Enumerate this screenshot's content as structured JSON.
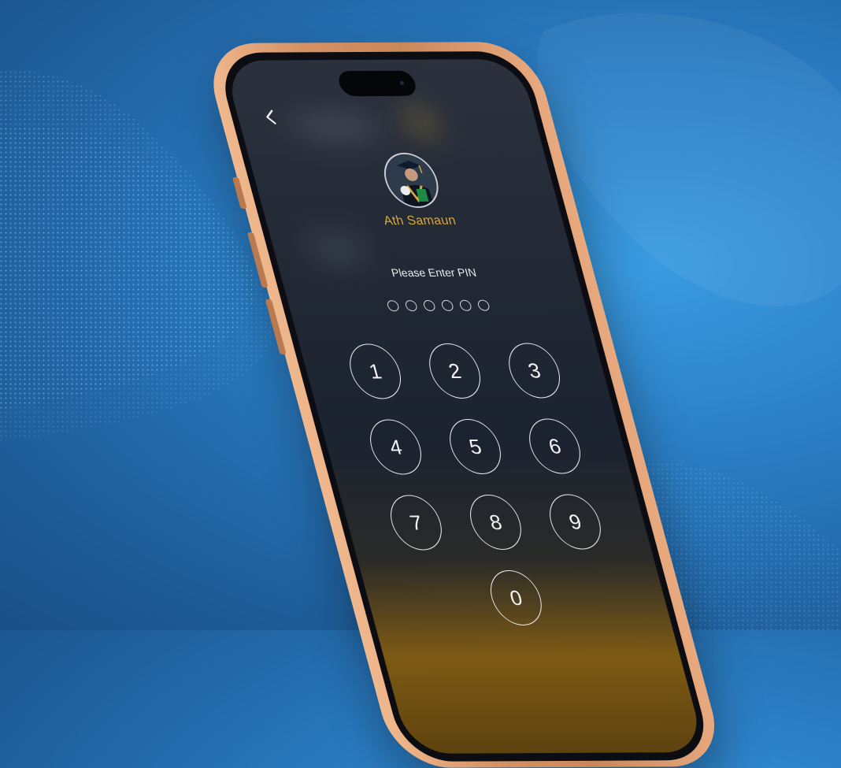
{
  "app": {
    "user_name": "Ath Samaun",
    "pin_prompt": "Please Enter PIN",
    "pin_length": 6,
    "pin_entered": 0
  },
  "icons": {
    "back": "chevron-left-icon",
    "avatar": "user-photo"
  },
  "keypad": {
    "keys": [
      "1",
      "2",
      "3",
      "4",
      "5",
      "6",
      "7",
      "8",
      "9",
      "0"
    ]
  },
  "colors": {
    "background": "#2b7fc6",
    "phone_frame": "#d69263",
    "screen": "#1c2330",
    "accent_name": "#d9a83a",
    "key_outline": "#e6e8ec"
  }
}
